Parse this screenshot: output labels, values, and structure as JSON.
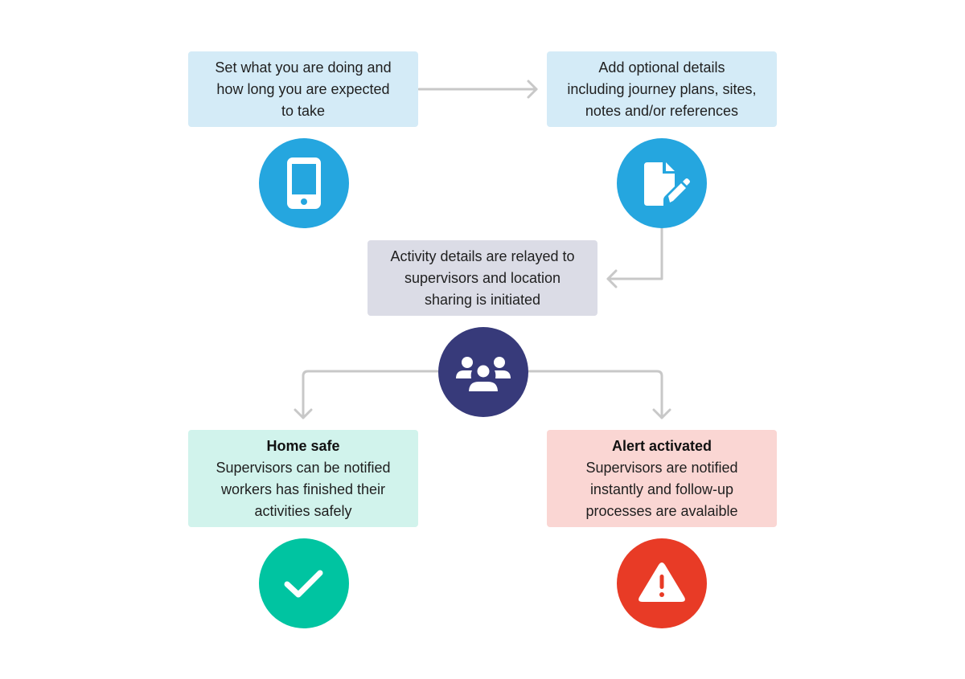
{
  "diagram": {
    "steps": [
      {
        "id": "set-activity",
        "text": "Set what you are doing and\nhow long you are expected\nto take",
        "color": "#d4ebf7"
      },
      {
        "id": "add-details",
        "text": "Add optional details\nincluding journey plans, sites,\nnotes and/or references",
        "color": "#d4ebf7"
      },
      {
        "id": "relay",
        "text": "Activity details are relayed to\nsupervisors and location\nsharing is initiated",
        "color": "#dbdce6"
      },
      {
        "id": "home-safe",
        "title": "Home safe",
        "text": "Supervisors can be notified\nworkers has finished their\nactivities safely",
        "color": "#d1f3ec"
      },
      {
        "id": "alert",
        "title": "Alert activated",
        "text": "Supervisors are notified\ninstantly and follow-up\nprocesses are avalaible",
        "color": "#fad6d3"
      }
    ],
    "icons": [
      {
        "name": "smartphone-icon",
        "color": "#25a6df"
      },
      {
        "name": "document-edit-icon",
        "color": "#25a6df"
      },
      {
        "name": "users-group-icon",
        "color": "#373a7a"
      },
      {
        "name": "checkmark-icon",
        "color": "#00c4a1"
      },
      {
        "name": "warning-icon",
        "color": "#e83b26"
      }
    ],
    "connector_color": "#c8c8c8",
    "flow": [
      [
        "set-activity",
        "add-details"
      ],
      [
        "add-details",
        "relay"
      ],
      [
        "relay",
        "home-safe"
      ],
      [
        "relay",
        "alert"
      ]
    ]
  }
}
